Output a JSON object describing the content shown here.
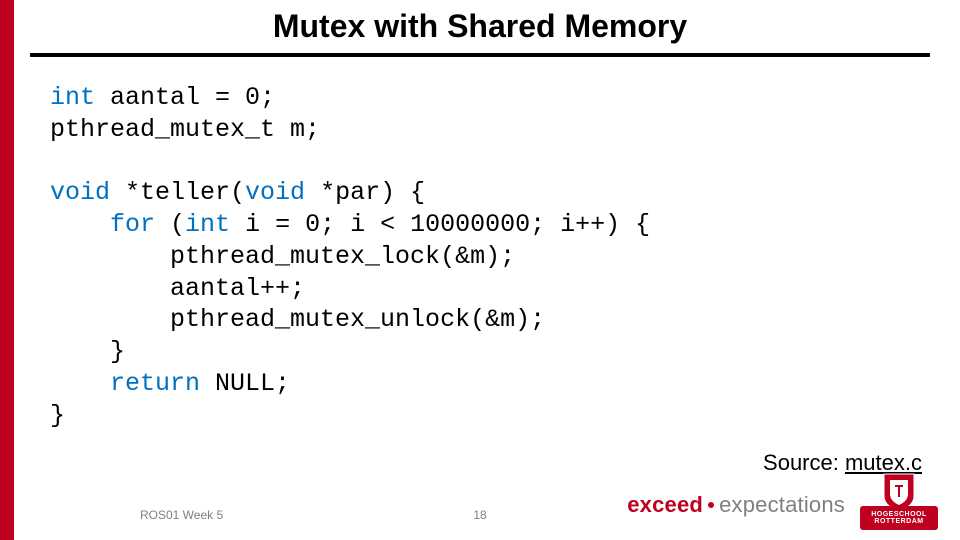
{
  "title": "Mutex with Shared Memory",
  "code": {
    "kw_int": "int",
    "l1_rest": " aantal = 0;",
    "l2": "pthread_mutex_t m;",
    "kw_void1": "void",
    "l3_mid": " *teller(",
    "kw_void2": "void",
    "l3_end": " *par) {",
    "indent1": "    ",
    "kw_for": "for",
    "l4_mid": " (",
    "kw_int2": "int",
    "l4_end": " i = 0; i < 10000000; i++) {",
    "l5": "        pthread_mutex_lock(&m);",
    "l6": "        aantal++;",
    "l7": "        pthread_mutex_unlock(&m);",
    "l8": "    }",
    "indent2": "    ",
    "kw_return": "return",
    "l9_end": " NULL;",
    "l10": "}"
  },
  "source": {
    "label": "Source: ",
    "link": "mutex.c"
  },
  "footer": {
    "left": "ROS01 Week 5",
    "page": "18"
  },
  "brand": {
    "exceed": "exceed",
    "expect": "expectations"
  },
  "logo": {
    "line1": "HOGESCHOOL",
    "line2": "ROTTERDAM"
  }
}
